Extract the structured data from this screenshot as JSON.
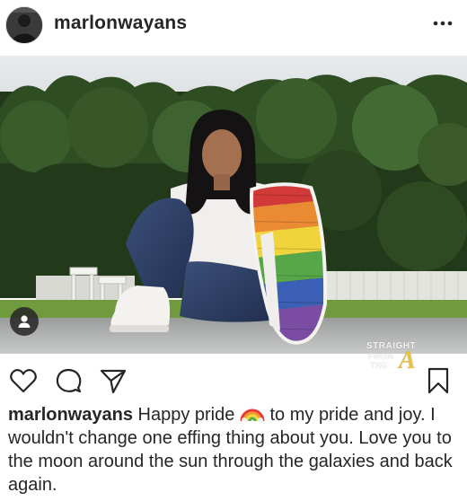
{
  "post": {
    "username": "marlonwayans",
    "more_icon": "more-horizontal-icon",
    "caption": {
      "username": "marlonwayans",
      "text_before_emoji": "Happy pride",
      "emoji": "rainbow-emoji",
      "text_after_emoji": "to my pride and joy. I wouldn't change one effing thing about you. Love you to the moon around the sun through the galaxies and back again."
    }
  },
  "watermark": {
    "line1": "STRAIGHT",
    "line2": "FROM",
    "line3": "THE",
    "logo_letter": "A"
  },
  "colors": {
    "text": "#262626",
    "watermark_accent": "#e8c14a"
  },
  "actions": {
    "like_icon": "heart-icon",
    "comment_icon": "comment-icon",
    "share_icon": "paper-plane-icon",
    "save_icon": "bookmark-icon",
    "tag_icon": "user-tag-icon"
  }
}
